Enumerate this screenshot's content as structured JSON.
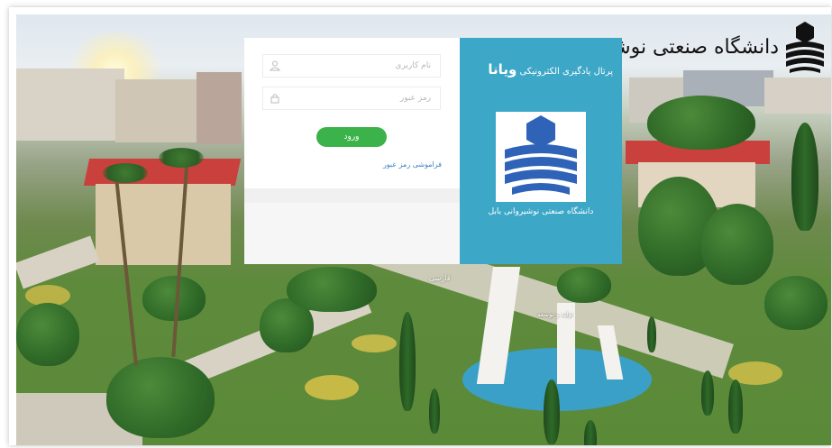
{
  "brand": {
    "university_text": "دانشگاه صنعتی نوشیروانی",
    "logo_icon": "university-emblem-icon"
  },
  "login": {
    "username_placeholder": "نام کاربری",
    "password_placeholder": "رمز عبور",
    "submit_label": "ورود",
    "forgot_label": "فراموشی رمز عبور",
    "user_icon": "user-icon",
    "lock_icon": "lock-icon"
  },
  "portal": {
    "title_prefix": "پرتال یادگیری الکترونیکی",
    "title_brand": "ویانا",
    "university_name": "دانشگاه صنعتی نوشیروانی بابل",
    "logo_icon": "university-emblem-icon"
  },
  "footer": {
    "language": "فارسی",
    "credit": "تولید و توسعه"
  },
  "colors": {
    "accent_panel": "#3da7c8",
    "login_button": "#3cb34a",
    "link": "#3a7ec6",
    "logo_blue": "#2f63b8"
  }
}
